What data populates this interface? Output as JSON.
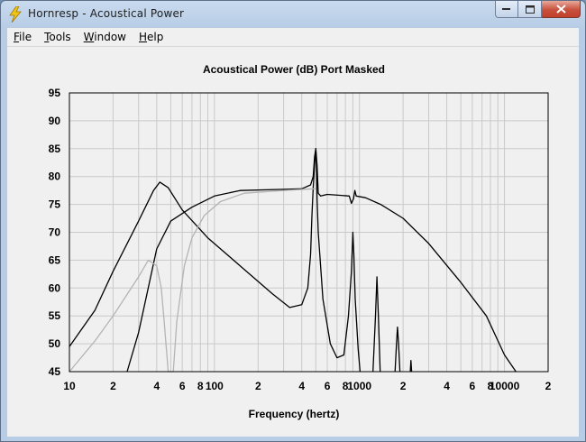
{
  "window": {
    "title": "Hornresp - Acoustical Power"
  },
  "menu": [
    {
      "accel": "F",
      "rest": "ile"
    },
    {
      "accel": "T",
      "rest": "ools"
    },
    {
      "accel": "W",
      "rest": "indow"
    },
    {
      "accel": "H",
      "rest": "elp"
    }
  ],
  "colors": {
    "accent": "#f0c419",
    "grid": "#c9c9c9",
    "trace_black": "#000000",
    "trace_gray": "#b4b4b4"
  },
  "chart_data": {
    "type": "line",
    "title": "Acoustical Power (dB)   Port   Masked",
    "xlabel": "Frequency (hertz)",
    "ylabel": "",
    "xscale": "log",
    "xlim": [
      10,
      20000
    ],
    "ylim": [
      45,
      95
    ],
    "yticks": [
      "95",
      "90",
      "85",
      "80",
      "75",
      "70",
      "65",
      "60",
      "55",
      "50",
      "45"
    ],
    "xticks": [
      "10",
      "2",
      "4",
      "6",
      "8",
      "100",
      "2",
      "4",
      "6",
      "8",
      "1000",
      "2",
      "4",
      "6",
      "8",
      "10000",
      "2"
    ],
    "grid": true,
    "series": [
      {
        "color": "black",
        "points": [
          [
            10,
            49.5
          ],
          [
            15,
            56
          ],
          [
            20,
            63
          ],
          [
            30,
            72
          ],
          [
            38,
            77.5
          ],
          [
            42,
            79
          ],
          [
            48,
            78
          ],
          [
            60,
            74
          ],
          [
            90,
            69
          ],
          [
            150,
            64
          ],
          [
            250,
            59
          ],
          [
            330,
            56.5
          ],
          [
            400,
            57
          ],
          [
            440,
            60
          ],
          [
            460,
            66
          ],
          [
            470,
            73
          ],
          [
            480,
            78
          ],
          [
            490,
            82
          ],
          [
            500,
            85
          ],
          [
            505,
            82
          ],
          [
            510,
            76
          ],
          [
            520,
            70
          ],
          [
            560,
            58
          ],
          [
            630,
            50
          ],
          [
            700,
            47.5
          ],
          [
            780,
            48
          ],
          [
            840,
            55
          ],
          [
            880,
            63
          ],
          [
            900,
            70
          ],
          [
            915,
            66
          ],
          [
            935,
            58
          ],
          [
            980,
            49
          ],
          [
            1010,
            45
          ]
        ]
      },
      {
        "color": "black",
        "points": [
          [
            25,
            45
          ],
          [
            30,
            52
          ],
          [
            40,
            67
          ],
          [
            50,
            72
          ],
          [
            70,
            74.5
          ],
          [
            100,
            76.5
          ],
          [
            150,
            77.5
          ],
          [
            300,
            77.7
          ],
          [
            400,
            77.8
          ],
          [
            460,
            78.5
          ],
          [
            480,
            80
          ],
          [
            490,
            83.5
          ],
          [
            500,
            85
          ],
          [
            510,
            82
          ],
          [
            520,
            77
          ],
          [
            540,
            76.5
          ],
          [
            600,
            76.8
          ],
          [
            850,
            76.5
          ],
          [
            880,
            75.2
          ],
          [
            910,
            76
          ],
          [
            930,
            77.5
          ],
          [
            950,
            76.5
          ],
          [
            1100,
            76.2
          ],
          [
            1400,
            75
          ],
          [
            2000,
            72.5
          ],
          [
            3000,
            68
          ],
          [
            5000,
            61
          ],
          [
            7500,
            55
          ],
          [
            10000,
            48
          ],
          [
            12000,
            45
          ]
        ]
      },
      {
        "color": "black",
        "points": [
          [
            1240,
            45
          ],
          [
            1290,
            55
          ],
          [
            1320,
            62
          ],
          [
            1350,
            55
          ],
          [
            1390,
            45
          ]
        ]
      },
      {
        "color": "black",
        "points": [
          [
            1760,
            45
          ],
          [
            1800,
            50
          ],
          [
            1830,
            53
          ],
          [
            1860,
            50
          ],
          [
            1900,
            45
          ]
        ]
      },
      {
        "color": "black",
        "points": [
          [
            2240,
            45
          ],
          [
            2265,
            47
          ],
          [
            2290,
            45
          ]
        ]
      },
      {
        "color": "gray",
        "points": [
          [
            10,
            45
          ],
          [
            15,
            50.5
          ],
          [
            20,
            55
          ],
          [
            30,
            62
          ],
          [
            35,
            65
          ],
          [
            40,
            64
          ],
          [
            43,
            60
          ],
          [
            45,
            54
          ],
          [
            47,
            48
          ],
          [
            48,
            45
          ],
          [
            52,
            45
          ],
          [
            55,
            54
          ],
          [
            62,
            64
          ],
          [
            70,
            69
          ],
          [
            85,
            73
          ],
          [
            110,
            75.5
          ],
          [
            160,
            77
          ],
          [
            300,
            77.5
          ],
          [
            480,
            77.8
          ],
          [
            500,
            77.8
          ]
        ]
      }
    ]
  }
}
